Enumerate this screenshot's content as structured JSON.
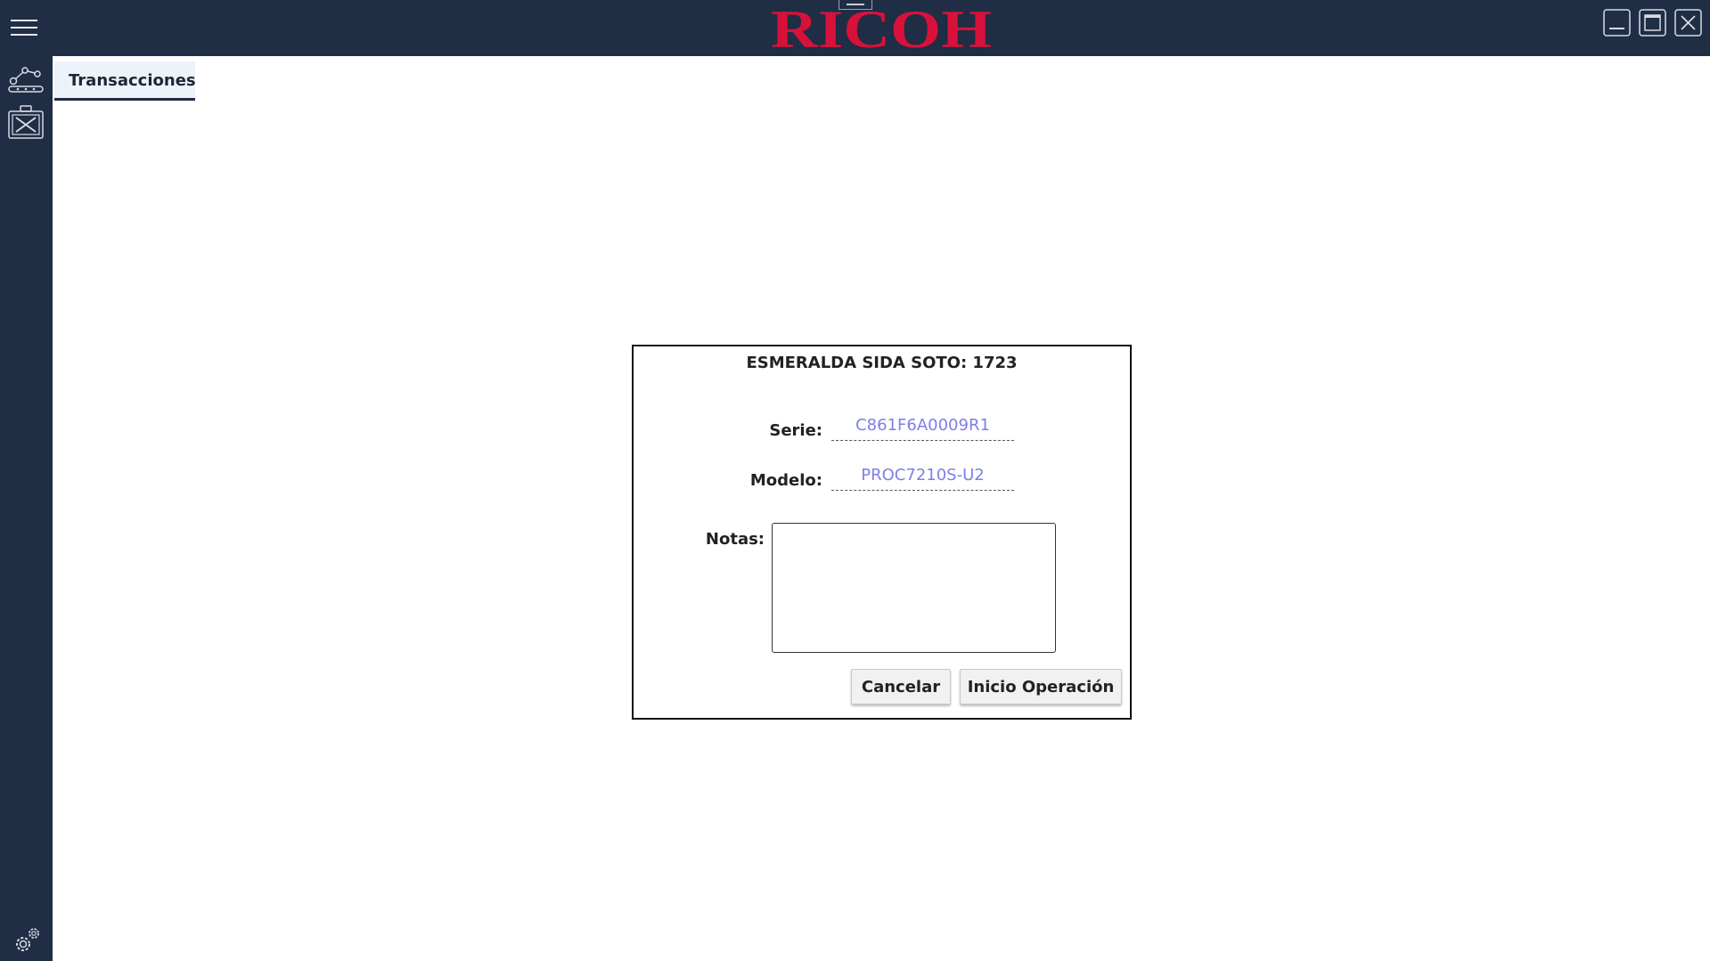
{
  "header": {
    "brand": "RICOH",
    "brand_color": "#d8113a",
    "background_color": "#1f2d45",
    "menu_icon": "hamburger-menu-icon",
    "window_controls": [
      "minimize-icon",
      "maximize-icon",
      "close-icon"
    ]
  },
  "sidebar": {
    "items": [
      {
        "icon": "network-route-icon"
      },
      {
        "icon": "toolbox-icon"
      }
    ],
    "footer_icon": "settings-gears-icon"
  },
  "tabs": [
    {
      "label": "Transacciones",
      "active": true
    }
  ],
  "dialog": {
    "title": "ESMERALDA SIDA SOTO: 1723",
    "serie_label": "Serie:",
    "serie_value": "C861F6A0009R1",
    "modelo_label": "Modelo:",
    "modelo_value": "PROC7210S-U2",
    "notas_label": "Notas:",
    "notas_value": "",
    "value_color": "#7d7fe8",
    "cancel_label": "Cancelar",
    "start_label": "Inicio Operación"
  }
}
